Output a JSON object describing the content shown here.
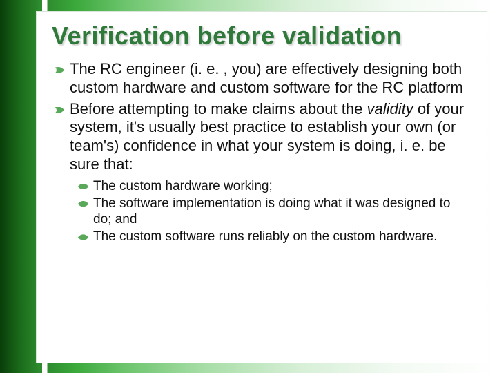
{
  "slide": {
    "title": "Verification before validation",
    "bullets": [
      {
        "pre": "The RC engineer (i. e. , you) are effectively designing both custom hardware and custom software for the RC platform"
      },
      {
        "pre": "Before attempting to make claims about the ",
        "italic": "validity",
        "post": " of your system, it's usually best practice to establish your own (or team's) confidence in what your system is doing, i. e. be sure that:"
      }
    ],
    "sub": [
      "The custom hardware working;",
      "The software implementation is doing what it was designed to do; and",
      "The custom software runs reliably on the custom hardware."
    ]
  }
}
